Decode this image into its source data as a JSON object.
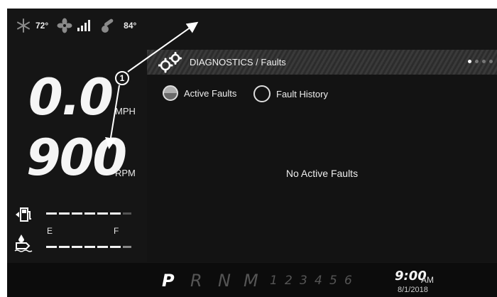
{
  "status_bar": {
    "snow_icon": "snowflake-icon",
    "temp_outside": "72°",
    "fan_icon": "fan-icon",
    "signal_icon": "signal-bars-icon",
    "thermo_icon": "thermometer-icon",
    "temp_engine": "84°"
  },
  "gauges": {
    "speed_value": "0.0",
    "speed_unit": "MPH",
    "rpm_value": "900",
    "rpm_unit": "RPM",
    "fuel_icon": "fuel-pump-icon",
    "fuel_level_fraction": 0.85,
    "fuel_empty_label": "E",
    "fuel_full_label": "F",
    "water_icon": "freshwater-tank-icon",
    "water_level_fraction": 0.85
  },
  "panel": {
    "header_icon": "gears-icon",
    "title": "DIAGNOSTICS / Faults",
    "page_indicator": {
      "total": 4,
      "active": 1
    },
    "options": [
      {
        "label": "Active Faults",
        "selected": true
      },
      {
        "label": "Fault History",
        "selected": false
      }
    ],
    "message": "No Active Faults"
  },
  "bottom_bar": {
    "gears": [
      "P",
      "R",
      "N",
      "M",
      "1",
      "2",
      "3",
      "4",
      "5",
      "6"
    ],
    "active_gear": "P",
    "time": "9:00",
    "ampm": "AM",
    "date": "8/1/2018"
  },
  "annotation": {
    "callout_number": "1"
  },
  "colors": {
    "screen_bg": "#151515",
    "panel_header": "#3a3a3a",
    "text": "#f0f0f0"
  }
}
